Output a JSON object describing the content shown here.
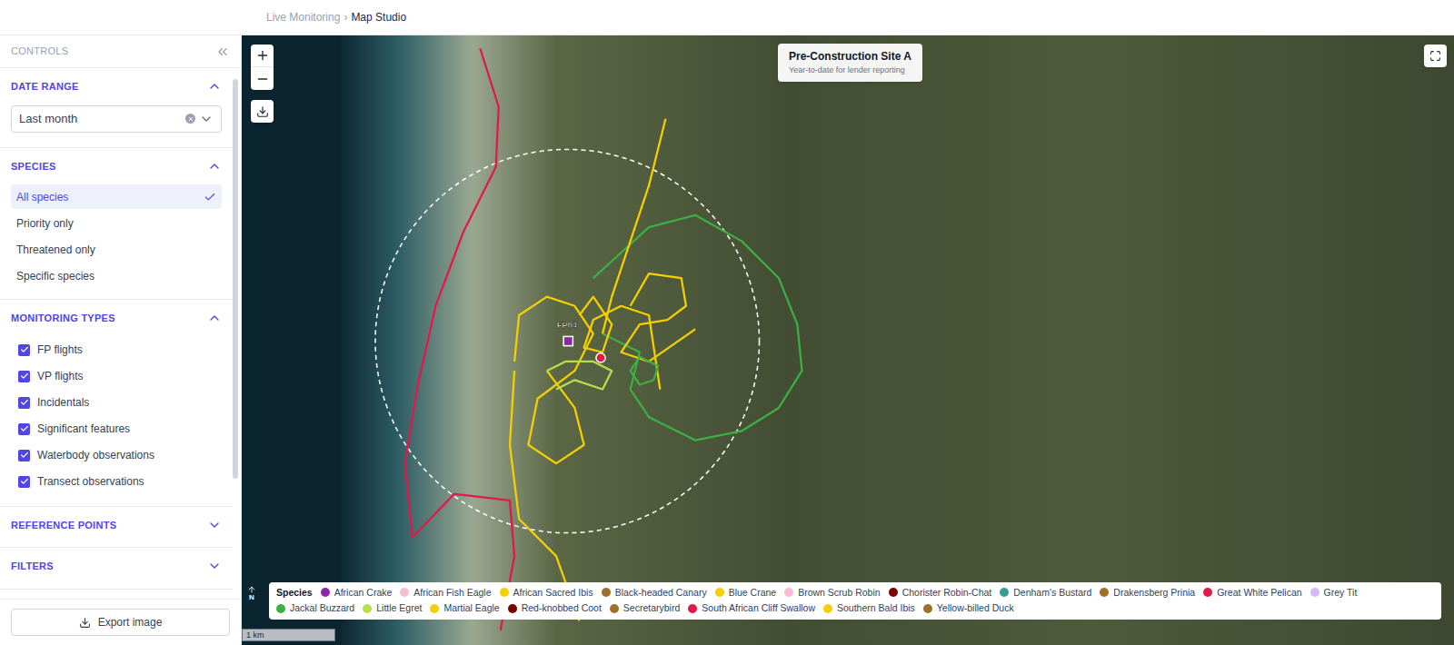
{
  "breadcrumb": {
    "parent": "Live Monitoring",
    "separator": "›",
    "current": "Map Studio"
  },
  "sidebar": {
    "title": "CONTROLS",
    "sections": [
      {
        "kind": "select",
        "title": "DATE RANGE",
        "expanded": true,
        "value": "Last month"
      },
      {
        "kind": "options",
        "title": "SPECIES",
        "expanded": true,
        "options": [
          {
            "label": "All species",
            "selected": true
          },
          {
            "label": "Priority only",
            "selected": false
          },
          {
            "label": "Threatened only",
            "selected": false
          },
          {
            "label": "Specific species",
            "selected": false
          }
        ]
      },
      {
        "kind": "checkboxes",
        "title": "MONITORING TYPES",
        "expanded": true,
        "items": [
          {
            "label": "FP flights",
            "checked": true
          },
          {
            "label": "VP flights",
            "checked": true
          },
          {
            "label": "Incidentals",
            "checked": true
          },
          {
            "label": "Significant features",
            "checked": true
          },
          {
            "label": "Waterbody observations",
            "checked": true
          },
          {
            "label": "Transect observations",
            "checked": true
          }
        ]
      },
      {
        "kind": "collapsed",
        "title": "REFERENCE POINTS",
        "expanded": false
      },
      {
        "kind": "collapsed",
        "title": "FILTERS",
        "expanded": false
      }
    ],
    "export_button": "Export image"
  },
  "map": {
    "title": "Pre-Construction Site A",
    "subtitle": "Year-to-date for lender reporting",
    "legend_title": "Species",
    "legend": [
      {
        "label": "African Crake",
        "color": "#8e24aa"
      },
      {
        "label": "African Fish Eagle",
        "color": "#f8bbd0"
      },
      {
        "label": "African Sacred Ibis",
        "color": "#f5d000"
      },
      {
        "label": "Black-headed Canary",
        "color": "#a0702a"
      },
      {
        "label": "Blue Crane",
        "color": "#f5d000"
      },
      {
        "label": "Brown Scrub Robin",
        "color": "#f8bbd0"
      },
      {
        "label": "Chorister Robin-Chat",
        "color": "#7b0000"
      },
      {
        "label": "Denham's Bustard",
        "color": "#3a9d8f"
      },
      {
        "label": "Drakensberg Prinia",
        "color": "#a0702a"
      },
      {
        "label": "Great White Pelican",
        "color": "#e0194a"
      },
      {
        "label": "Grey Tit",
        "color": "#d6b8f5"
      },
      {
        "label": "Jackal Buzzard",
        "color": "#3cb043"
      },
      {
        "label": "Little Egret",
        "color": "#b5e04a"
      },
      {
        "label": "Martial Eagle",
        "color": "#f5d000"
      },
      {
        "label": "Red-knobbed Coot",
        "color": "#7b0000"
      },
      {
        "label": "Secretarybird",
        "color": "#a0702a"
      },
      {
        "label": "South African Cliff Swallow",
        "color": "#e0194a"
      },
      {
        "label": "Southern Bald Ibis",
        "color": "#f5d000"
      },
      {
        "label": "Yellow-billed Duck",
        "color": "#a0702a"
      }
    ],
    "scale": "1 km",
    "north": "N",
    "site": {
      "label": "FP04",
      "point": [
        613,
        368
      ],
      "color": "#8e24aa"
    },
    "incident": {
      "point": [
        648,
        386
      ],
      "color": "#e0194a"
    },
    "buffer": {
      "center": [
        612,
        368
      ],
      "radius": 207
    },
    "tracks": [
      {
        "color": "#e0194a",
        "points": [
          [
            518,
            52
          ],
          [
            538,
            115
          ],
          [
            535,
            180
          ],
          [
            500,
            250
          ],
          [
            470,
            330
          ],
          [
            450,
            420
          ],
          [
            437,
            500
          ],
          [
            445,
            580
          ],
          [
            490,
            533
          ],
          [
            550,
            540
          ],
          [
            555,
            600
          ],
          [
            540,
            680
          ]
        ]
      },
      {
        "color": "#3cb043",
        "points": [
          [
            640,
            300
          ],
          [
            700,
            245
          ],
          [
            750,
            232
          ],
          [
            800,
            260
          ],
          [
            840,
            300
          ],
          [
            860,
            350
          ],
          [
            865,
            400
          ],
          [
            840,
            440
          ],
          [
            800,
            465
          ],
          [
            750,
            475
          ],
          [
            700,
            450
          ],
          [
            680,
            420
          ],
          [
            690,
            380
          ],
          [
            650,
            360
          ]
        ]
      },
      {
        "color": "#f5d000",
        "points": [
          [
            718,
            128
          ],
          [
            700,
            200
          ],
          [
            680,
            260
          ],
          [
            660,
            320
          ],
          [
            650,
            360
          ]
        ]
      },
      {
        "color": "#f5d000",
        "points": [
          [
            555,
            390
          ],
          [
            560,
            340
          ],
          [
            590,
            320
          ],
          [
            620,
            330
          ],
          [
            640,
            360
          ],
          [
            620,
            400
          ],
          [
            580,
            430
          ],
          [
            570,
            480
          ],
          [
            600,
            500
          ],
          [
            630,
            480
          ],
          [
            620,
            440
          ],
          [
            590,
            400
          ]
        ]
      },
      {
        "color": "#f5d000",
        "points": [
          [
            555,
            400
          ],
          [
            550,
            480
          ],
          [
            560,
            560
          ],
          [
            600,
            600
          ],
          [
            625,
            670
          ]
        ]
      },
      {
        "color": "#f5d000",
        "points": [
          [
            680,
            330
          ],
          [
            700,
            295
          ],
          [
            735,
            300
          ],
          [
            740,
            330
          ],
          [
            720,
            345
          ],
          [
            690,
            350
          ],
          [
            670,
            380
          ],
          [
            700,
            390
          ],
          [
            750,
            355
          ]
        ]
      },
      {
        "color": "#f5d000",
        "points": [
          [
            625,
            340
          ],
          [
            640,
            320
          ],
          [
            660,
            350
          ],
          [
            650,
            380
          ],
          [
            630,
            375
          ],
          [
            640,
            345
          ],
          [
            670,
            330
          ],
          [
            700,
            340
          ],
          [
            712,
            420
          ]
        ]
      },
      {
        "color": "#b5e04a",
        "points": [
          [
            590,
            400
          ],
          [
            610,
            390
          ],
          [
            640,
            390
          ],
          [
            660,
            400
          ],
          [
            650,
            420
          ],
          [
            620,
            410
          ],
          [
            600,
            420
          ]
        ]
      },
      {
        "color": "#3cb043",
        "points": [
          [
            690,
            385
          ],
          [
            710,
            395
          ],
          [
            705,
            410
          ],
          [
            690,
            415
          ],
          [
            680,
            400
          ],
          [
            690,
            385
          ]
        ]
      }
    ]
  }
}
